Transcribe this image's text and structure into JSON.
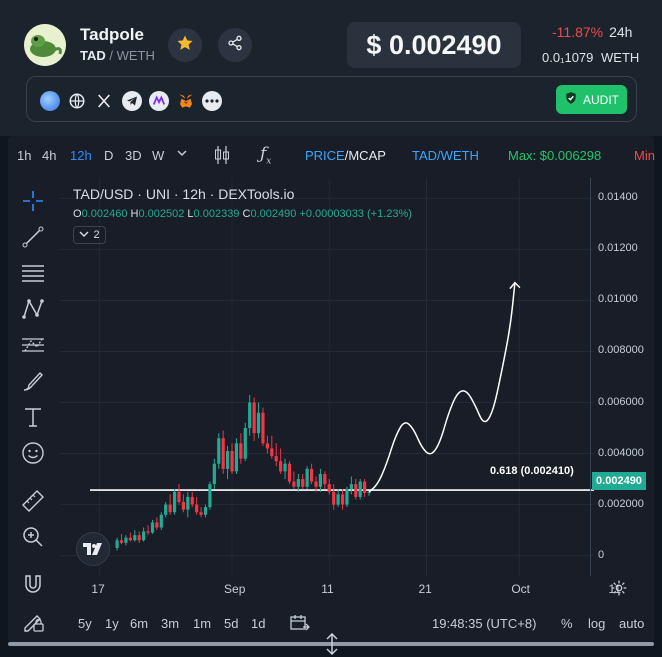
{
  "token": {
    "name": "Tadpole",
    "symbol": "TAD",
    "separator": " / ",
    "quote": "WETH",
    "price": "$ 0.002490",
    "change": "-11.87%",
    "change_timeframe": "24h",
    "weth_price": "0.0₁1079",
    "weth_label": "WETH"
  },
  "links": {
    "audit_label": "AUDIT",
    "icons": [
      "blue-orb-icon",
      "globe-icon",
      "x-twitter-icon",
      "telegram-icon",
      "dextools-icon",
      "metamask-icon",
      "more-icon"
    ]
  },
  "toolbar": {
    "intervals": [
      "1h",
      "4h",
      "12h",
      "D",
      "3D",
      "W"
    ],
    "active_interval": "12h",
    "price_label": "PRICE",
    "mcap_label": "/MCAP",
    "pair_label": "TAD/WETH",
    "max_label": "Max: $0.006298",
    "min_label": "Min"
  },
  "legend": {
    "title": "TAD/USD · UNI · 12h · DEXTools.io",
    "o_label": "O",
    "o": "0.002460",
    "h_label": "H",
    "h": "0.002502",
    "l_label": "L",
    "l": "0.002339",
    "c_label": "C",
    "c": "0.002490",
    "delta": "+0.00003033 (+1.23%)",
    "indicator_count": "2"
  },
  "fib": {
    "label": "0.618 (0.002410)",
    "level": 0.00241
  },
  "current_price_tag": "0.002490",
  "bottom": {
    "ranges": [
      "5y",
      "1y",
      "6m",
      "3m",
      "1m",
      "5d",
      "1d"
    ],
    "clock": "19:48:35 (UTC+8)",
    "pct": "%",
    "log": "log",
    "auto": "auto"
  },
  "colors": {
    "up": "#22ab94",
    "down": "#f23645",
    "accent": "#2f8cff",
    "audit": "#1fc16b",
    "negative": "#f0494f"
  },
  "chart_data": {
    "type": "candlestick",
    "y_ticks": [
      "0.01400",
      "0.01200",
      "0.01000",
      "0.008000",
      "0.006000",
      "0.004000",
      "0.002000",
      "0"
    ],
    "ylim": [
      -0.0008,
      0.0148
    ],
    "x_ticks": [
      "17",
      "Sep",
      "11",
      "21",
      "Oct",
      "11"
    ],
    "x_tick_index": [
      1,
      31,
      53,
      75,
      96,
      118
    ],
    "candles": [
      {
        "i": 5,
        "o": 0.0003,
        "h": 0.0007,
        "l": 0.0002,
        "c": 0.0006
      },
      {
        "i": 6,
        "o": 0.0006,
        "h": 0.00085,
        "l": 0.00045,
        "c": 0.0005
      },
      {
        "i": 7,
        "o": 0.0005,
        "h": 0.0008,
        "l": 0.0004,
        "c": 0.0007
      },
      {
        "i": 8,
        "o": 0.0007,
        "h": 0.0009,
        "l": 0.00055,
        "c": 0.0006
      },
      {
        "i": 9,
        "o": 0.0006,
        "h": 0.001,
        "l": 0.00055,
        "c": 0.0008
      },
      {
        "i": 10,
        "o": 0.0008,
        "h": 0.00095,
        "l": 0.0005,
        "c": 0.0006
      },
      {
        "i": 11,
        "o": 0.0006,
        "h": 0.0011,
        "l": 0.00055,
        "c": 0.00095
      },
      {
        "i": 12,
        "o": 0.00095,
        "h": 0.0012,
        "l": 0.0008,
        "c": 0.0009
      },
      {
        "i": 13,
        "o": 0.0009,
        "h": 0.0014,
        "l": 0.00085,
        "c": 0.0013
      },
      {
        "i": 14,
        "o": 0.0013,
        "h": 0.0015,
        "l": 0.001,
        "c": 0.0011
      },
      {
        "i": 15,
        "o": 0.0011,
        "h": 0.0017,
        "l": 0.001,
        "c": 0.0016
      },
      {
        "i": 16,
        "o": 0.0016,
        "h": 0.0021,
        "l": 0.0015,
        "c": 0.002
      },
      {
        "i": 17,
        "o": 0.002,
        "h": 0.0024,
        "l": 0.0016,
        "c": 0.0017
      },
      {
        "i": 18,
        "o": 0.0017,
        "h": 0.0026,
        "l": 0.0016,
        "c": 0.0025
      },
      {
        "i": 19,
        "o": 0.0025,
        "h": 0.0028,
        "l": 0.002,
        "c": 0.0021
      },
      {
        "i": 20,
        "o": 0.0021,
        "h": 0.0024,
        "l": 0.0017,
        "c": 0.0018
      },
      {
        "i": 21,
        "o": 0.0018,
        "h": 0.0025,
        "l": 0.0015,
        "c": 0.0023
      },
      {
        "i": 22,
        "o": 0.0023,
        "h": 0.0025,
        "l": 0.0019,
        "c": 0.002
      },
      {
        "i": 23,
        "o": 0.002,
        "h": 0.0023,
        "l": 0.0016,
        "c": 0.0017
      },
      {
        "i": 24,
        "o": 0.0017,
        "h": 0.0019,
        "l": 0.0015,
        "c": 0.0016
      },
      {
        "i": 25,
        "o": 0.0016,
        "h": 0.002,
        "l": 0.0015,
        "c": 0.0019
      },
      {
        "i": 26,
        "o": 0.0019,
        "h": 0.0029,
        "l": 0.0018,
        "c": 0.0028
      },
      {
        "i": 27,
        "o": 0.0028,
        "h": 0.0038,
        "l": 0.0026,
        "c": 0.0036
      },
      {
        "i": 28,
        "o": 0.0036,
        "h": 0.0048,
        "l": 0.0034,
        "c": 0.0046
      },
      {
        "i": 29,
        "o": 0.0046,
        "h": 0.0049,
        "l": 0.0032,
        "c": 0.0034
      },
      {
        "i": 30,
        "o": 0.0034,
        "h": 0.0043,
        "l": 0.003,
        "c": 0.0041
      },
      {
        "i": 31,
        "o": 0.0041,
        "h": 0.0044,
        "l": 0.0032,
        "c": 0.0033
      },
      {
        "i": 32,
        "o": 0.0033,
        "h": 0.0046,
        "l": 0.0032,
        "c": 0.0044
      },
      {
        "i": 33,
        "o": 0.0044,
        "h": 0.0048,
        "l": 0.0036,
        "c": 0.0038
      },
      {
        "i": 34,
        "o": 0.0038,
        "h": 0.0052,
        "l": 0.0037,
        "c": 0.005
      },
      {
        "i": 35,
        "o": 0.005,
        "h": 0.0063,
        "l": 0.0047,
        "c": 0.006
      },
      {
        "i": 36,
        "o": 0.006,
        "h": 0.0062,
        "l": 0.0045,
        "c": 0.0048
      },
      {
        "i": 37,
        "o": 0.0048,
        "h": 0.006,
        "l": 0.0046,
        "c": 0.0056
      },
      {
        "i": 38,
        "o": 0.0056,
        "h": 0.0058,
        "l": 0.0043,
        "c": 0.0044
      },
      {
        "i": 39,
        "o": 0.0044,
        "h": 0.0047,
        "l": 0.004,
        "c": 0.0042
      },
      {
        "i": 40,
        "o": 0.0042,
        "h": 0.0047,
        "l": 0.0038,
        "c": 0.0039
      },
      {
        "i": 41,
        "o": 0.0039,
        "h": 0.0044,
        "l": 0.0035,
        "c": 0.0037
      },
      {
        "i": 42,
        "o": 0.0037,
        "h": 0.0042,
        "l": 0.0032,
        "c": 0.0033
      },
      {
        "i": 43,
        "o": 0.0033,
        "h": 0.0038,
        "l": 0.003,
        "c": 0.0036
      },
      {
        "i": 44,
        "o": 0.0036,
        "h": 0.0037,
        "l": 0.0028,
        "c": 0.0029
      },
      {
        "i": 45,
        "o": 0.0029,
        "h": 0.0033,
        "l": 0.0026,
        "c": 0.0027
      },
      {
        "i": 46,
        "o": 0.0027,
        "h": 0.0032,
        "l": 0.0025,
        "c": 0.003
      },
      {
        "i": 47,
        "o": 0.003,
        "h": 0.0032,
        "l": 0.0026,
        "c": 0.0027
      },
      {
        "i": 48,
        "o": 0.0027,
        "h": 0.0035,
        "l": 0.0026,
        "c": 0.0034
      },
      {
        "i": 49,
        "o": 0.0034,
        "h": 0.0036,
        "l": 0.0028,
        "c": 0.0029
      },
      {
        "i": 50,
        "o": 0.0029,
        "h": 0.0031,
        "l": 0.0025,
        "c": 0.0027
      },
      {
        "i": 51,
        "o": 0.0027,
        "h": 0.0034,
        "l": 0.0025,
        "c": 0.0032
      },
      {
        "i": 52,
        "o": 0.0032,
        "h": 0.0033,
        "l": 0.0026,
        "c": 0.0028
      },
      {
        "i": 53,
        "o": 0.0028,
        "h": 0.003,
        "l": 0.0024,
        "c": 0.0025
      },
      {
        "i": 54,
        "o": 0.0025,
        "h": 0.0028,
        "l": 0.0018,
        "c": 0.002
      },
      {
        "i": 55,
        "o": 0.002,
        "h": 0.0026,
        "l": 0.0019,
        "c": 0.0024
      },
      {
        "i": 56,
        "o": 0.0024,
        "h": 0.0026,
        "l": 0.0018,
        "c": 0.002
      },
      {
        "i": 57,
        "o": 0.002,
        "h": 0.0027,
        "l": 0.0019,
        "c": 0.0026
      },
      {
        "i": 58,
        "o": 0.0026,
        "h": 0.0031,
        "l": 0.0024,
        "c": 0.0028
      },
      {
        "i": 59,
        "o": 0.0028,
        "h": 0.003,
        "l": 0.0022,
        "c": 0.0023
      },
      {
        "i": 60,
        "o": 0.0023,
        "h": 0.003,
        "l": 0.0022,
        "c": 0.0029
      },
      {
        "i": 61,
        "o": 0.0029,
        "h": 0.003,
        "l": 0.0023,
        "c": 0.00246
      },
      {
        "i": 62,
        "o": 0.00246,
        "h": 0.0025,
        "l": 0.00234,
        "c": 0.00249
      }
    ],
    "projection": [
      [
        62,
        0.00249
      ],
      [
        64,
        0.0028
      ],
      [
        66,
        0.0036
      ],
      [
        68,
        0.0047
      ],
      [
        70,
        0.0053
      ],
      [
        72,
        0.005
      ],
      [
        74,
        0.0042
      ],
      [
        76,
        0.0039
      ],
      [
        78,
        0.0044
      ],
      [
        80,
        0.0056
      ],
      [
        82,
        0.0064
      ],
      [
        84,
        0.0065
      ],
      [
        86,
        0.0059
      ],
      [
        88,
        0.0051
      ],
      [
        90,
        0.0056
      ],
      [
        92,
        0.0072
      ],
      [
        94,
        0.009
      ],
      [
        95,
        0.0107
      ]
    ]
  }
}
